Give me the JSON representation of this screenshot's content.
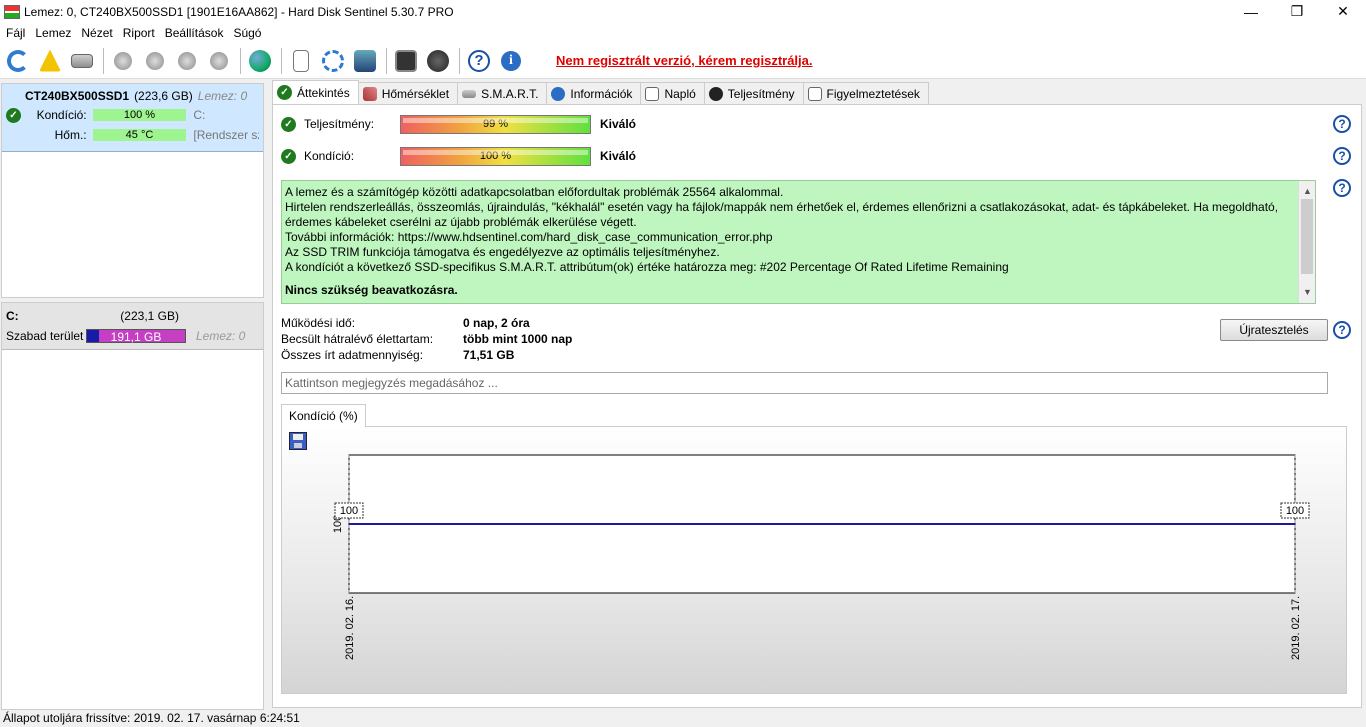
{
  "window": {
    "title": "Lemez: 0, CT240BX500SSD1 [1901E16AA862]  -  Hard Disk Sentinel 5.30.7 PRO",
    "minimize": "—",
    "maximize": "❐",
    "close": "✕"
  },
  "menu": [
    "Fájl",
    "Lemez",
    "Nézet",
    "Riport",
    "Beállítások",
    "Súgó"
  ],
  "toolbar": {
    "icons": [
      "refresh-icon",
      "warning-icon",
      "disk-icon",
      "probe-icon",
      "probe-check-icon",
      "probe-ok-icon",
      "probe-search-icon",
      "globe-icon",
      "document-icon",
      "sync-icon",
      "network-icon",
      "terminal-icon",
      "speaker-icon",
      "help-icon",
      "info-icon"
    ],
    "help_glyph": "?",
    "info_glyph": "i",
    "register_link": "Nem regisztrált verzió, kérem regisztrálja."
  },
  "disk": {
    "name": "CT240BX500SSD1",
    "size": "(223,6 GB)",
    "id": "Lemez: 0",
    "condition_label": "Kondíció:",
    "condition_value": "100 %",
    "condition_extra": "C:",
    "temp_label": "Hőm.:",
    "temp_value": "45 °C",
    "temp_extra": "[Rendszer szá"
  },
  "volume": {
    "letter": "C:",
    "size": "(223,1 GB)",
    "free_label": "Szabad terület",
    "free_value": "191,1 GB",
    "disk_id": "Lemez: 0"
  },
  "tabs": [
    "Áttekintés",
    "Hőmérséklet",
    "S.M.A.R.T.",
    "Információk",
    "Napló",
    "Teljesítmény",
    "Figyelmeztetések"
  ],
  "overview": {
    "performance_label": "Teljesítmény:",
    "performance_value": "99 %",
    "performance_level": 0.99,
    "performance_word": "Kiváló",
    "condition_label": "Kondíció:",
    "condition_value": "100 %",
    "condition_level": 1.0,
    "condition_word": "Kiváló",
    "help": "?",
    "message_lines": [
      "A lemez és a számítógép közötti adatkapcsolatban előfordultak problémák 25564 alkalommal.",
      "Hirtelen rendszerleállás, összeomlás, újraindulás, \"kékhalál\" esetén vagy ha fájlok/mappák nem érhetőek el, érdemes ellenőrizni a csatlakozásokat, adat- és tápkábeleket. Ha megoldható, érdemes kábeleket cserélni az újabb problémák elkerülése végett.",
      "További információk: https://www.hdsentinel.com/hard_disk_case_communication_error.php",
      "Az SSD TRIM funkciója támogatva és engedélyezve az optimális teljesítményhez.",
      "A kondíciót a következő SSD-specifikus S.M.A.R.T. attribútum(ok) értéke határozza meg:  #202 Percentage Of Rated Lifetime Remaining"
    ],
    "message_bold": "Nincs szükség beavatkozásra.",
    "scroll_up": "▲",
    "scroll_down": "▼",
    "uptime_label": "Működési idő:",
    "uptime_value": "0 nap, 2 óra",
    "lifetime_label": "Becsült hátralévő élettartam:",
    "lifetime_value": "több mint 1000 nap",
    "written_label": "Összes írt adatmennyiség:",
    "written_value": "71,51 GB",
    "retest_button": "Újratesztelés",
    "note_placeholder": "Kattintson megjegyzés megadásához ..."
  },
  "chart_tab": "Kondíció  (%)",
  "chart_data": {
    "type": "line",
    "x": [
      "2019. 02. 16.",
      "2019. 02. 17."
    ],
    "series": [
      {
        "values": [
          100,
          100
        ]
      }
    ],
    "point_labels": [
      "100",
      "100"
    ],
    "ytick": "100",
    "ylim": [
      0,
      200
    ],
    "line_color": "#1a1aa0"
  },
  "status": "Állapot utoljára frissítve: 2019. 02. 17. vasárnap 6:24:51"
}
